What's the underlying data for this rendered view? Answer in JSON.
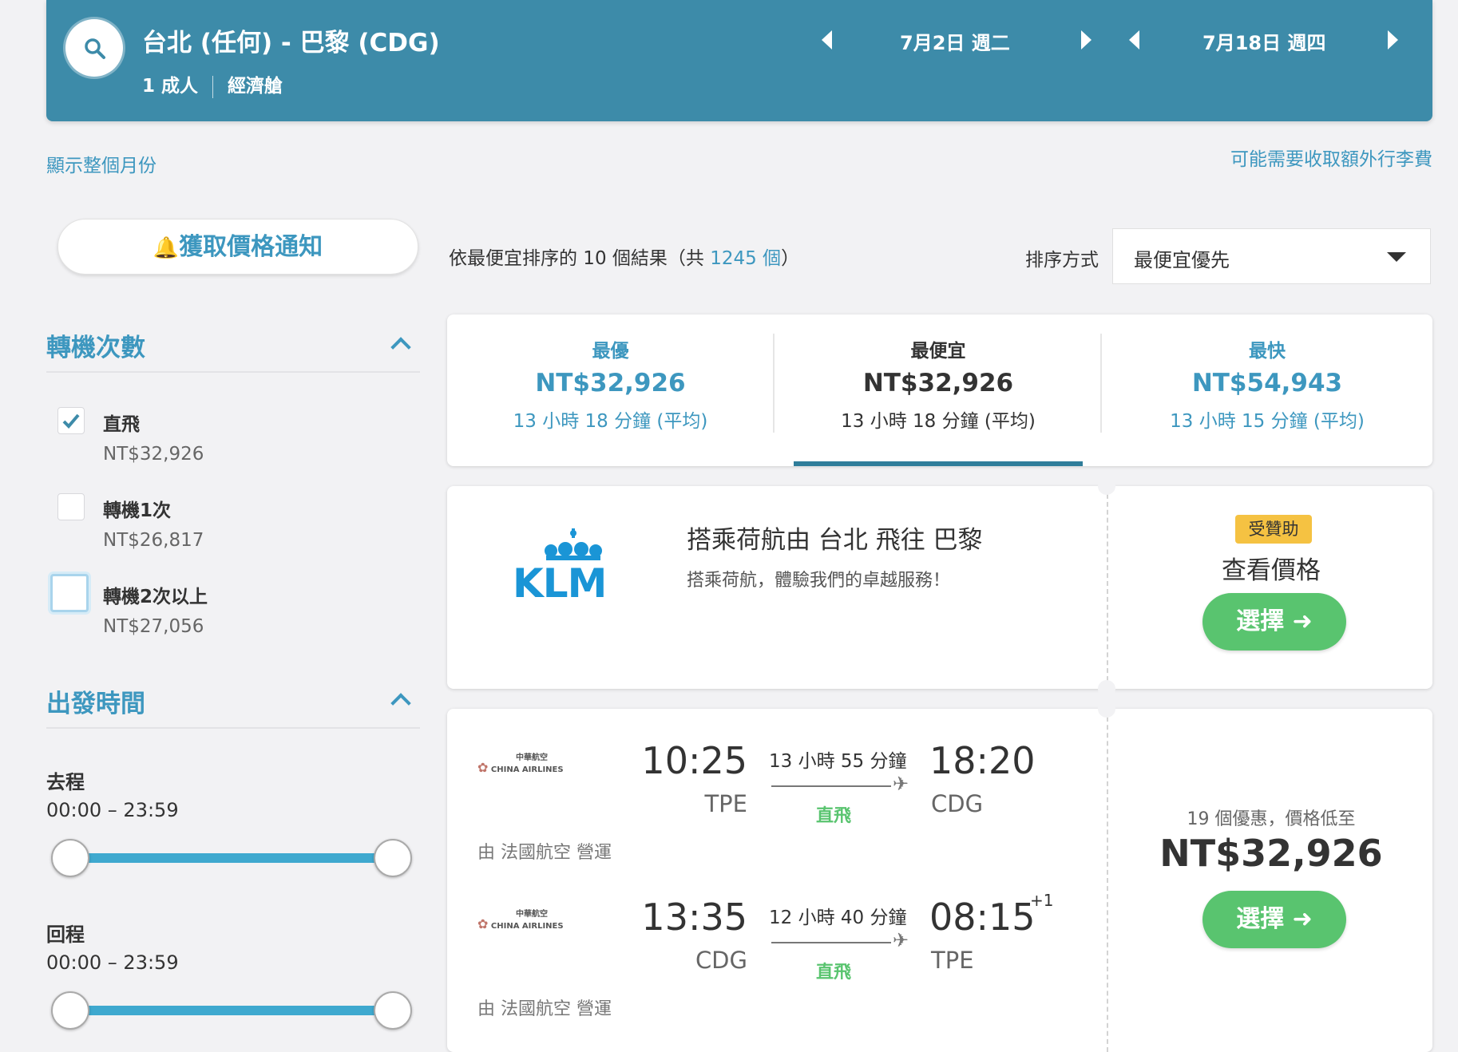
{
  "header": {
    "route": "台北 (任何) - 巴黎 (CDG)",
    "passengers": "1 成人",
    "cabin": "經濟艙",
    "depart_date": "7月2日 週二",
    "return_date": "7月18日 週四"
  },
  "links": {
    "show_month": "顯示整個月份",
    "baggage_fee": "可能需要收取額外行李費"
  },
  "sidebar": {
    "price_alert": "獲取價格通知",
    "stops": {
      "title": "轉機次數",
      "options": [
        {
          "label": "直飛",
          "price": "NT$32,926",
          "checked": true
        },
        {
          "label": "轉機1次",
          "price": "NT$26,817",
          "checked": false
        },
        {
          "label": "轉機2次以上",
          "price": "NT$27,056",
          "checked": false
        }
      ]
    },
    "departure_time": {
      "title": "出發時間",
      "outbound_label": "去程",
      "outbound_range": "00:00 – 23:59",
      "return_label": "回程",
      "return_range": "00:00 – 23:59"
    }
  },
  "results": {
    "summary_prefix": "依最便宜排序的 10 個結果（共 ",
    "total": "1245 個",
    "summary_suffix": "）",
    "sort_label": "排序方式",
    "sort_value": "最便宜優先"
  },
  "tabs": [
    {
      "label": "最優",
      "price": "NT$32,926",
      "duration": "13 小時 18 分鐘 (平均)"
    },
    {
      "label": "最便宜",
      "price": "NT$32,926",
      "duration": "13 小時 18 分鐘 (平均)"
    },
    {
      "label": "最快",
      "price": "NT$54,943",
      "duration": "13 小時 15 分鐘 (平均)"
    }
  ],
  "ad": {
    "logo": "KLM",
    "title": "搭乘荷航由 台北 飛往 巴黎",
    "subtitle": "搭乘荷航，體驗我們的卓越服務！",
    "badge": "受贊助",
    "cta": "查看價格",
    "button": "選擇"
  },
  "flight": {
    "airline": "CHINA AIRLINES",
    "airline_cn": "中華航空",
    "legs": [
      {
        "dep_time": "10:25",
        "dep_code": "TPE",
        "duration": "13 小時 55 分鐘",
        "stops": "直飛",
        "arr_time": "18:20",
        "arr_code": "CDG",
        "day_offset": "",
        "operated_by": "由 法國航空 營運"
      },
      {
        "dep_time": "13:35",
        "dep_code": "CDG",
        "duration": "12 小時 40 分鐘",
        "stops": "直飛",
        "arr_time": "08:15",
        "arr_code": "TPE",
        "day_offset": "+1",
        "operated_by": "由 法國航空 營運"
      }
    ],
    "deals": "19 個優惠，價格低至",
    "price": "NT$32,926",
    "button": "選擇"
  },
  "colors": {
    "brand": "#3d8ba9",
    "link": "#3d97bf",
    "green": "#59c46f",
    "badge": "#f5c242"
  }
}
